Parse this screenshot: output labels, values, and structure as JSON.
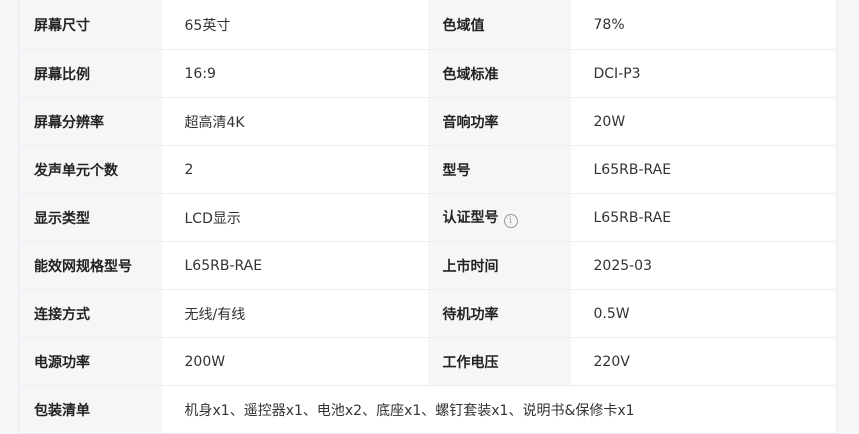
{
  "specs": {
    "rows": [
      {
        "l1": "屏幕尺寸",
        "v1": "65英寸",
        "l2": "色域值",
        "v2": "78%"
      },
      {
        "l1": "屏幕比例",
        "v1": "16:9",
        "l2": "色域标准",
        "v2": "DCI-P3"
      },
      {
        "l1": "屏幕分辨率",
        "v1": "超高清4K",
        "l2": "音响功率",
        "v2": "20W"
      },
      {
        "l1": "发声单元个数",
        "v1": "2",
        "l2": "型号",
        "v2": "L65RB-RAE"
      },
      {
        "l1": "显示类型",
        "v1": "LCD显示",
        "l2": "认证型号",
        "v2": "L65RB-RAE"
      },
      {
        "l1": "能效网规格型号",
        "v1": "L65RB-RAE",
        "l2": "上市时间",
        "v2": "2025-03"
      },
      {
        "l1": "连接方式",
        "v1": "无线/有线",
        "l2": "待机功率",
        "v2": "0.5W"
      },
      {
        "l1": "电源功率",
        "v1": "200W",
        "l2": "工作电压",
        "v2": "220V"
      }
    ],
    "package": {
      "label": "包装清单",
      "value": "机身x1、遥控器x1、电池x2、底座x1、螺钉套装x1、说明书&保修卡x1"
    },
    "info_icon": "info-icon",
    "info_glyph": "i"
  }
}
